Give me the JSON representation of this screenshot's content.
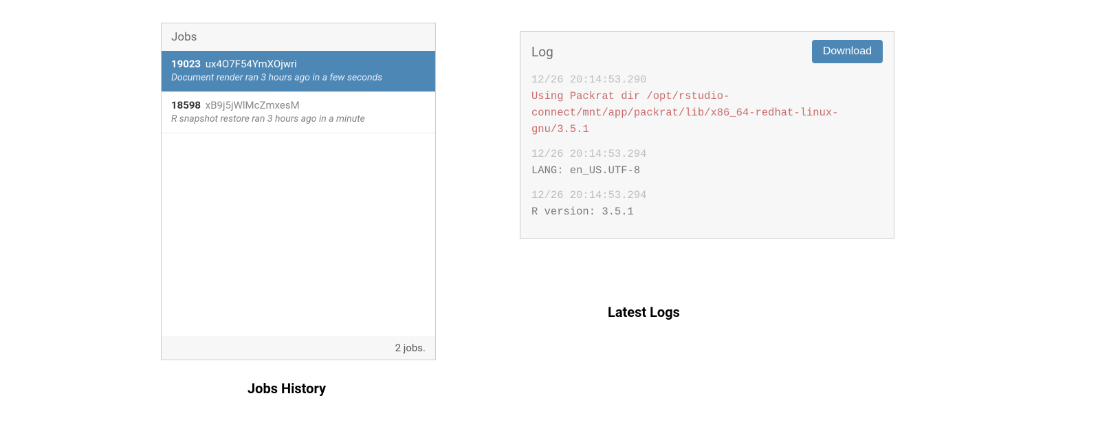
{
  "jobs_panel": {
    "title": "Jobs",
    "footer": "2 jobs.",
    "items": [
      {
        "id": "19023",
        "hash": "ux4O7F54YmXOjwri",
        "subtitle": "Document render ran 3 hours ago in a few seconds",
        "selected": true
      },
      {
        "id": "18598",
        "hash": "xB9j5jWlMcZmxesM",
        "subtitle": "R snapshot restore ran 3 hours ago in a minute",
        "selected": false
      }
    ]
  },
  "log_panel": {
    "title": "Log",
    "download_label": "Download",
    "entries": [
      {
        "timestamp": "12/26 20:14:53.290",
        "message": "Using Packrat dir /opt/rstudio-connect/mnt/app/packrat/lib/x86_64-redhat-linux-gnu/3.5.1",
        "color": "red"
      },
      {
        "timestamp": "12/26 20:14:53.294",
        "message": "LANG: en_US.UTF-8",
        "color": "gray"
      },
      {
        "timestamp": "12/26 20:14:53.294",
        "message": "R version: 3.5.1",
        "color": "gray"
      }
    ]
  },
  "captions": {
    "jobs": "Jobs History",
    "logs": "Latest Logs"
  }
}
